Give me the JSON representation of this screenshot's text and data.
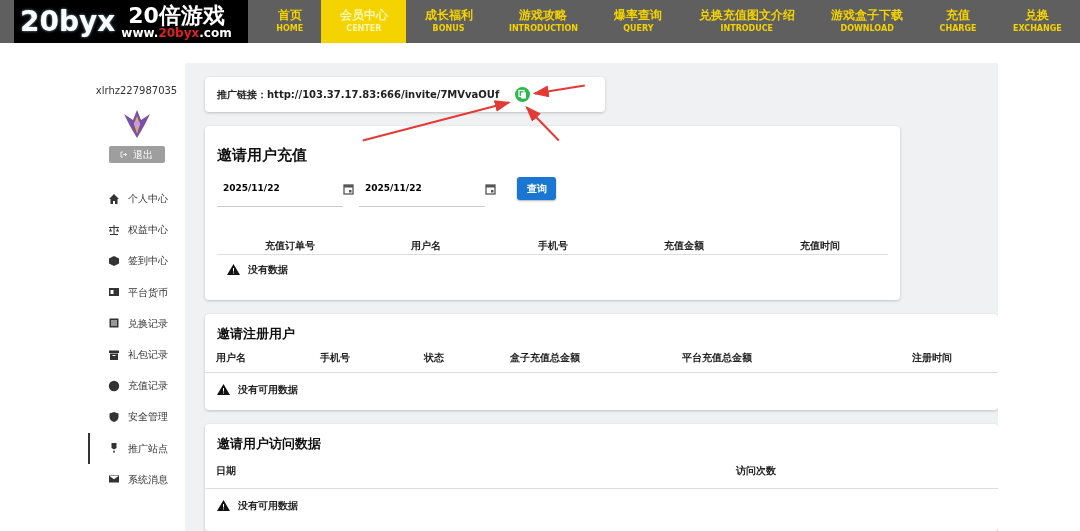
{
  "logo": {
    "brand": "20byx",
    "name": "20倍游戏",
    "url_parts": [
      {
        "text": "www.",
        "highlight": false
      },
      {
        "text": "20byx",
        "highlight": true
      },
      {
        "text": ".com",
        "highlight": false
      }
    ]
  },
  "nav": [
    {
      "label": "首页",
      "sub": "HOME",
      "selected": false
    },
    {
      "label": "会员中心",
      "sub": "CENTER",
      "selected": true
    },
    {
      "label": "成长福利",
      "sub": "BONUS",
      "selected": false
    },
    {
      "label": "游戏攻略",
      "sub": "INTRODUCTION",
      "selected": false
    },
    {
      "label": "爆率查询",
      "sub": "QUERY",
      "selected": false
    },
    {
      "label": "兑换充值图文介绍",
      "sub": "INTRODUCE",
      "selected": false
    },
    {
      "label": "游戏盒子下载",
      "sub": "DOWNLOAD",
      "selected": false
    },
    {
      "label": "充值",
      "sub": "CHARGE",
      "selected": false
    },
    {
      "label": "兑换",
      "sub": "EXCHANGE",
      "selected": false
    }
  ],
  "sidebar": {
    "username": "xlrhz227987035",
    "logout": "退出",
    "items": [
      {
        "label": "个人中心",
        "selected": false
      },
      {
        "label": "权益中心",
        "selected": false
      },
      {
        "label": "签到中心",
        "selected": false
      },
      {
        "label": "平台货币",
        "selected": false
      },
      {
        "label": "兑换记录",
        "selected": false
      },
      {
        "label": "礼包记录",
        "selected": false
      },
      {
        "label": "充值记录",
        "selected": false
      },
      {
        "label": "安全管理",
        "selected": false
      },
      {
        "label": "推广站点",
        "selected": true
      },
      {
        "label": "系统消息",
        "selected": false
      }
    ]
  },
  "promo_link": {
    "label": "推广链接：http://103.37.17.83:666/invite/7MVvaOUf"
  },
  "recharge": {
    "title": "邀请用户充值",
    "start_date": "2025/11/22",
    "end_date": "2025/11/22",
    "query_button": "查询",
    "columns": [
      "充值订单号",
      "用户名",
      "手机号",
      "充值金额",
      "充值时间"
    ],
    "empty": "没有数据"
  },
  "registered": {
    "title": "邀请注册用户",
    "columns": [
      "用户名",
      "手机号",
      "状态",
      "盒子充值总金额",
      "平台充值总金额",
      "注册时间"
    ],
    "empty": "没有可用数据"
  },
  "visits": {
    "title": "邀请用户访问数据",
    "columns": [
      "日期",
      "访问次数"
    ],
    "empty": "没有可用数据"
  }
}
